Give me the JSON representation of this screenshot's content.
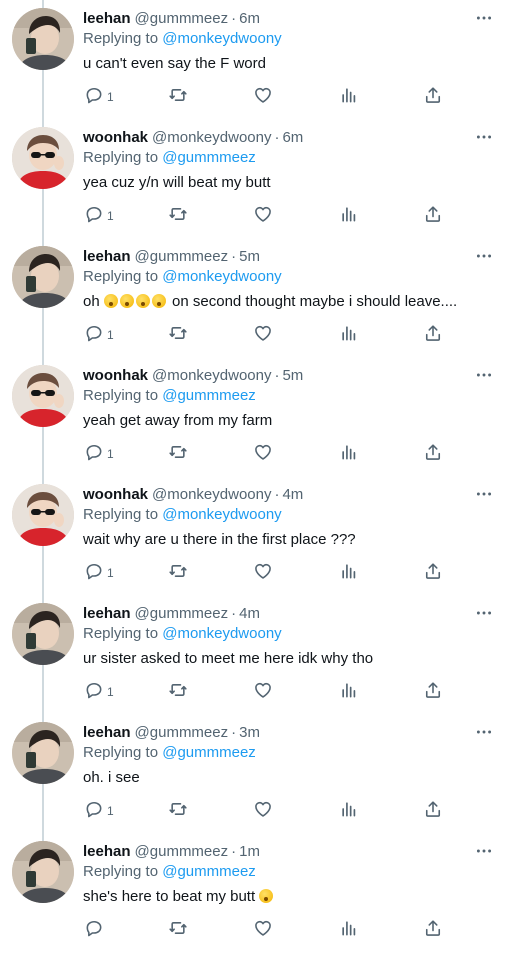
{
  "tweets": [
    {
      "author": "leehan",
      "handle": "@gummmeez",
      "time": "6m",
      "replying_label": "Replying to",
      "replying_to": "@monkeydwoony",
      "text": "u can't even say the F word",
      "emoji_count": 0,
      "text_after": "",
      "reply_count": "1",
      "avatar": "leehan"
    },
    {
      "author": "woonhak",
      "handle": "@monkeydwoony",
      "time": "6m",
      "replying_label": "Replying to",
      "replying_to": "@gummmeez",
      "text": "yea cuz y/n will beat my butt",
      "emoji_count": 0,
      "text_after": "",
      "reply_count": "1",
      "avatar": "woonhak"
    },
    {
      "author": "leehan",
      "handle": "@gummmeez",
      "time": "5m",
      "replying_label": "Replying to",
      "replying_to": "@monkeydwoony",
      "text": "oh",
      "emoji_count": 4,
      "text_after": "on second thought maybe i should leave....",
      "reply_count": "1",
      "avatar": "leehan"
    },
    {
      "author": "woonhak",
      "handle": "@monkeydwoony",
      "time": "5m",
      "replying_label": "Replying to",
      "replying_to": "@gummmeez",
      "text": "yeah get away from my farm",
      "emoji_count": 0,
      "text_after": "",
      "reply_count": "1",
      "avatar": "woonhak"
    },
    {
      "author": "woonhak",
      "handle": "@monkeydwoony",
      "time": "4m",
      "replying_label": "Replying to",
      "replying_to": "@monkeydwoony",
      "text": "wait why are u there in the first place ???",
      "emoji_count": 0,
      "text_after": "",
      "reply_count": "1",
      "avatar": "woonhak"
    },
    {
      "author": "leehan",
      "handle": "@gummmeez",
      "time": "4m",
      "replying_label": "Replying to",
      "replying_to": "@monkeydwoony",
      "text": "ur sister asked to meet me here idk why tho",
      "emoji_count": 0,
      "text_after": "",
      "reply_count": "1",
      "avatar": "leehan"
    },
    {
      "author": "leehan",
      "handle": "@gummmeez",
      "time": "3m",
      "replying_label": "Replying to",
      "replying_to": "@gummmeez",
      "text": "oh. i see",
      "emoji_count": 0,
      "text_after": "",
      "reply_count": "1",
      "avatar": "leehan"
    },
    {
      "author": "leehan",
      "handle": "@gummmeez",
      "time": "1m",
      "replying_label": "Replying to",
      "replying_to": "@gummmeez",
      "text": "she's here to beat my butt",
      "emoji_count": 1,
      "text_after": "",
      "reply_count": "",
      "avatar": "leehan"
    }
  ],
  "icons": {
    "reply": "reply-icon",
    "retweet": "retweet-icon",
    "like": "like-icon",
    "views": "views-icon",
    "share": "share-icon",
    "more": "more-icon"
  },
  "colors": {
    "text": "#0f1419",
    "secondary": "#536471",
    "link": "#1d9bf0",
    "thread_line": "#cfd9de"
  }
}
